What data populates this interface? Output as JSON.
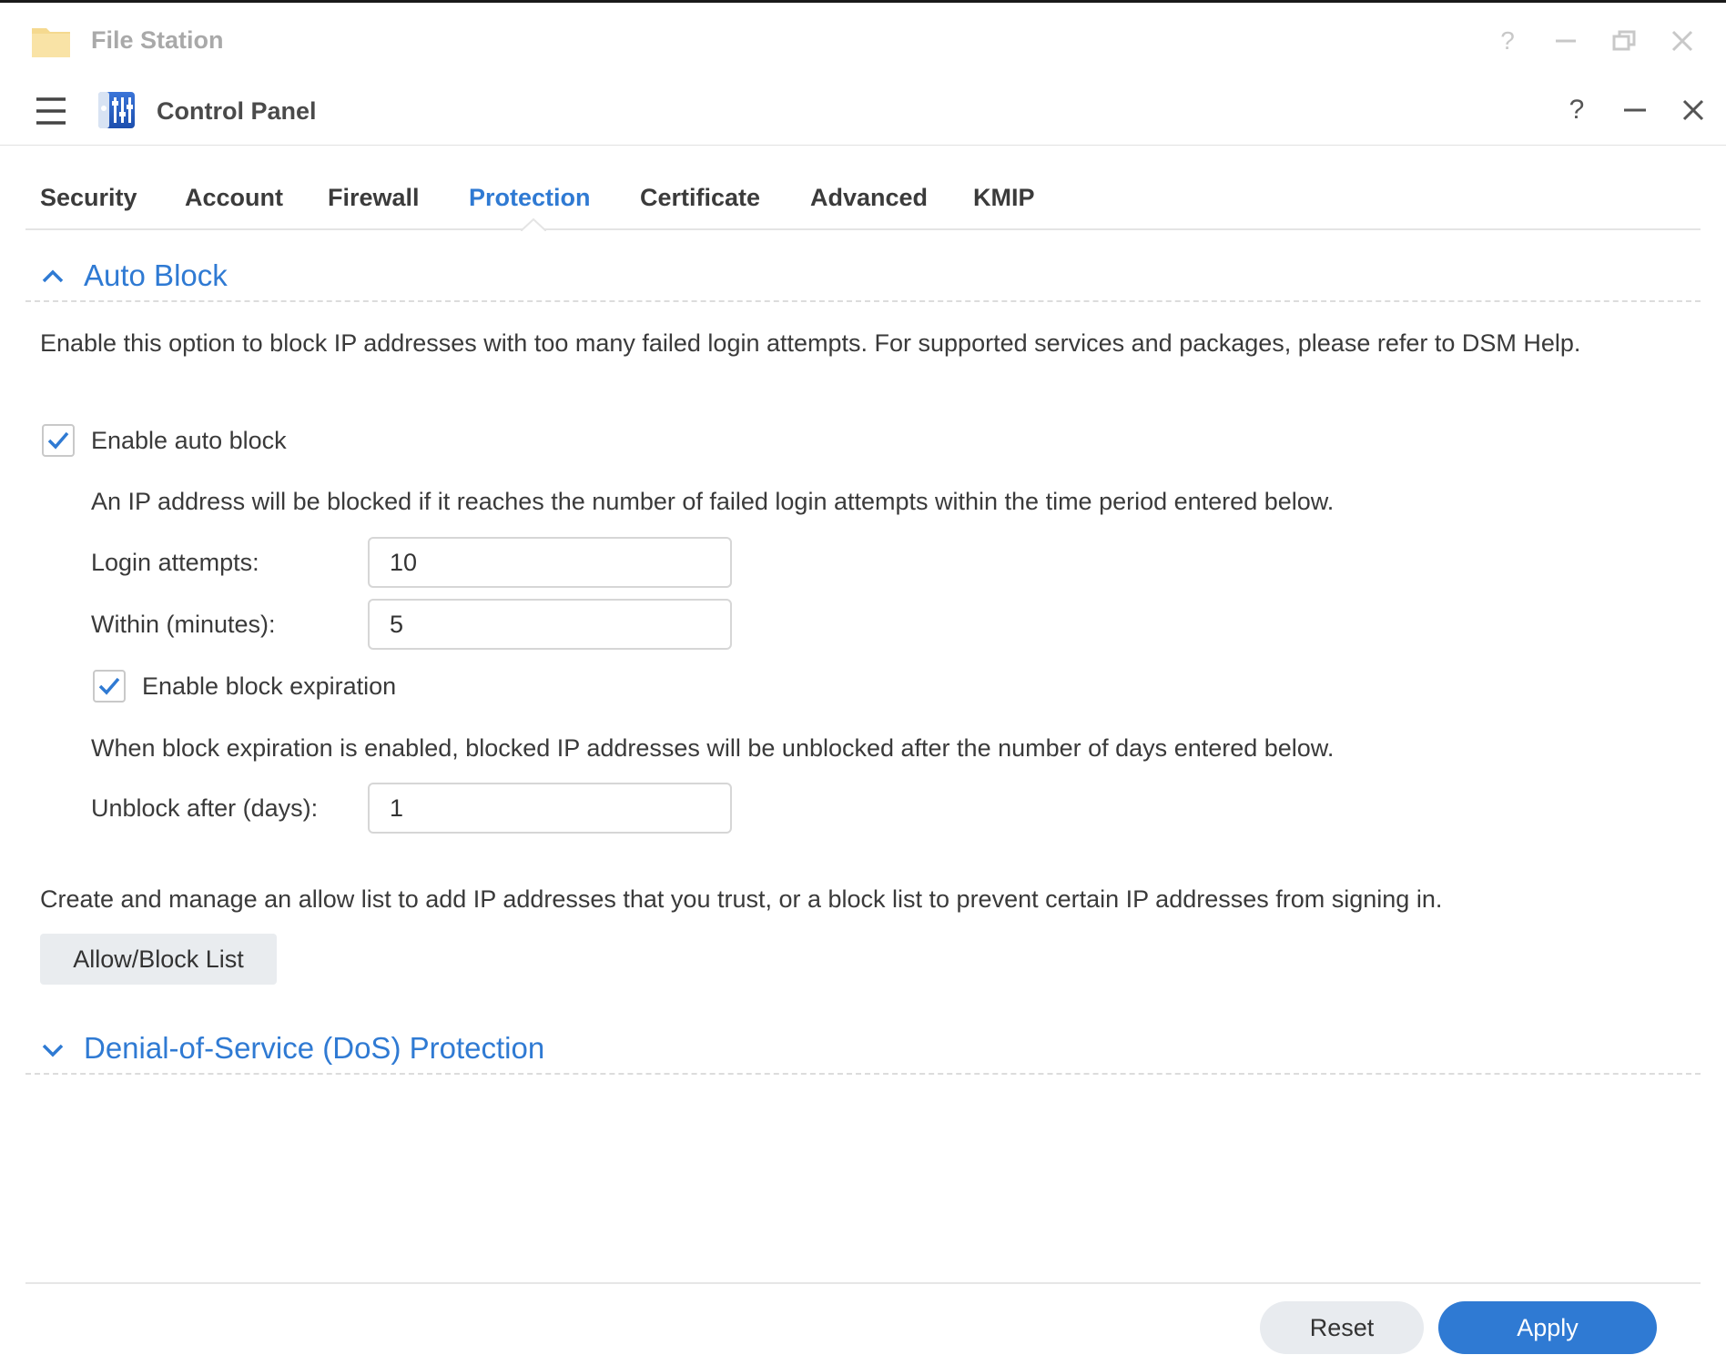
{
  "background_window": {
    "title": "File Station",
    "icon": "folder-icon",
    "controls": [
      "help-icon",
      "minimize-icon",
      "restore-icon",
      "close-icon"
    ]
  },
  "window": {
    "title": "Control Panel",
    "icon": "control-panel-icon",
    "controls": [
      "help-icon",
      "minimize-icon",
      "close-icon"
    ]
  },
  "tabs": [
    {
      "label": "Security",
      "active": false
    },
    {
      "label": "Account",
      "active": false
    },
    {
      "label": "Firewall",
      "active": false
    },
    {
      "label": "Protection",
      "active": true
    },
    {
      "label": "Certificate",
      "active": false
    },
    {
      "label": "Advanced",
      "active": false
    },
    {
      "label": "KMIP",
      "active": false
    }
  ],
  "auto_block": {
    "title": "Auto Block",
    "expanded": true,
    "description": "Enable this option to block IP addresses with too many failed login attempts. For supported services and packages, please refer to DSM Help.",
    "enable_label": "Enable auto block",
    "enable_checked": true,
    "rule_description": "An IP address will be blocked if it reaches the number of failed login attempts within the time period entered below.",
    "login_attempts_label": "Login attempts:",
    "login_attempts_value": "10",
    "within_label": "Within (minutes):",
    "within_value": "5",
    "expiration_label": "Enable block expiration",
    "expiration_checked": true,
    "expiration_description": "When block expiration is enabled, blocked IP addresses will be unblocked after the number of days entered below.",
    "unblock_label": "Unblock after (days):",
    "unblock_value": "1",
    "list_description": "Create and manage an allow list to add IP addresses that you trust, or a block list to prevent certain IP addresses from signing in.",
    "list_button": "Allow/Block List"
  },
  "dos": {
    "title": "Denial-of-Service (DoS) Protection",
    "expanded": false
  },
  "footer": {
    "reset_label": "Reset",
    "apply_label": "Apply"
  },
  "colors": {
    "accent": "#2f7ad3",
    "text": "#3a3a3a",
    "muted_title": "#a9a9a9"
  }
}
